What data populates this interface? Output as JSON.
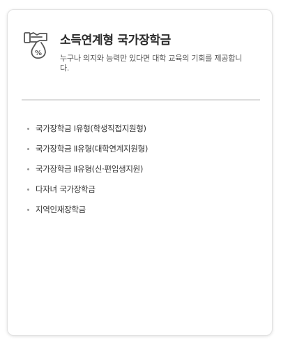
{
  "card": {
    "icon": "money-bag-percent-icon",
    "title": "소득연계형 국가장학금",
    "description": "누구나 의지와 능력만 있다면 대학 교육의 기회를 제공합니다.",
    "items": [
      "국가장학금 Ⅰ유형(학생직접지원형)",
      "국가장학금 Ⅱ유형(대학연계지원형)",
      "국가장학금 Ⅱ유형(신·편입생지원)",
      "다자녀 국가장학금",
      "지역인재장학금"
    ]
  },
  "colors": {
    "text": "#333333",
    "icon": "#555555",
    "divider": "#dcdcdc",
    "border": "#e2e2e2"
  }
}
